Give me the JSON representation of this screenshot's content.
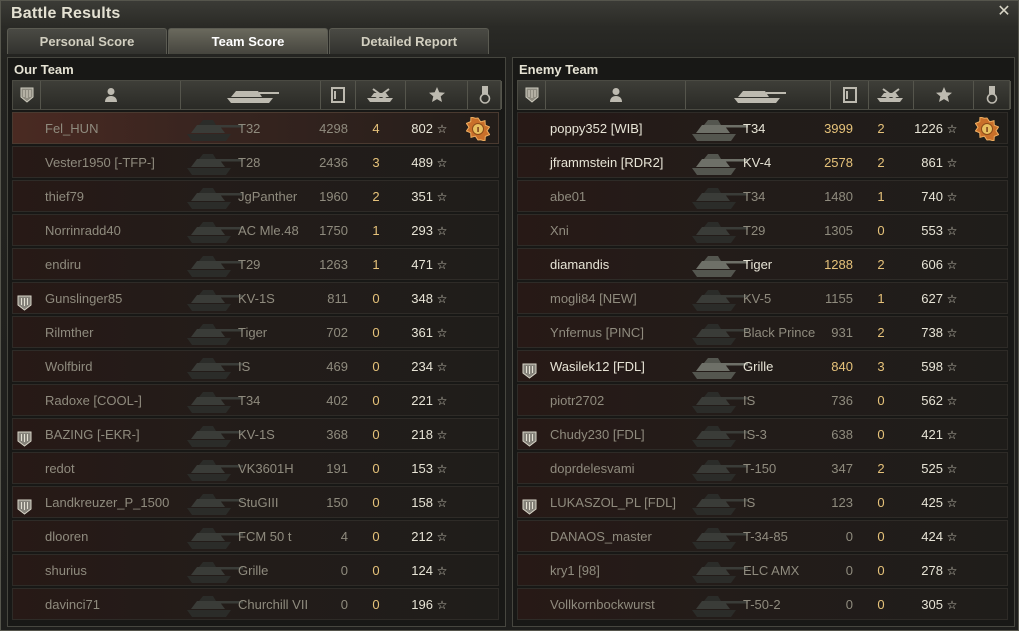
{
  "window": {
    "title": "Battle Results"
  },
  "tabs": [
    {
      "label": "Personal Score",
      "active": false
    },
    {
      "label": "Team Score",
      "active": true
    },
    {
      "label": "Detailed Report",
      "active": false
    }
  ],
  "columns_icons": [
    "badge-icon",
    "player-icon",
    "tank-icon",
    "damage-icon",
    "kills-icon",
    "experience-icon",
    "medal-icon"
  ],
  "our_team": {
    "title": "Our Team",
    "rows": [
      {
        "name": "Fel_HUN",
        "tank": "T32",
        "damage": "4298",
        "kills": "4",
        "xp": "802",
        "badge": false,
        "medal": true,
        "alive": false,
        "self": true
      },
      {
        "name": "Vester1950 [-TFP-]",
        "tank": "T28",
        "damage": "2436",
        "kills": "3",
        "xp": "489",
        "badge": false,
        "medal": false,
        "alive": false
      },
      {
        "name": "thief79",
        "tank": "JgPanther",
        "damage": "1960",
        "kills": "2",
        "xp": "351",
        "badge": false,
        "medal": false,
        "alive": false
      },
      {
        "name": "Norrinradd40",
        "tank": "AC Mle.48",
        "damage": "1750",
        "kills": "1",
        "xp": "293",
        "badge": false,
        "medal": false,
        "alive": false
      },
      {
        "name": "endiru",
        "tank": "T29",
        "damage": "1263",
        "kills": "1",
        "xp": "471",
        "badge": false,
        "medal": false,
        "alive": false
      },
      {
        "name": "Gunslinger85",
        "tank": "KV-1S",
        "damage": "811",
        "kills": "0",
        "xp": "348",
        "badge": true,
        "medal": false,
        "alive": false
      },
      {
        "name": "Rilmther",
        "tank": "Tiger",
        "damage": "702",
        "kills": "0",
        "xp": "361",
        "badge": false,
        "medal": false,
        "alive": false
      },
      {
        "name": "Wolfbird",
        "tank": "IS",
        "damage": "469",
        "kills": "0",
        "xp": "234",
        "badge": false,
        "medal": false,
        "alive": false
      },
      {
        "name": "Radoxe [COOL-]",
        "tank": "T34",
        "damage": "402",
        "kills": "0",
        "xp": "221",
        "badge": false,
        "medal": false,
        "alive": false
      },
      {
        "name": "BAZING [-EKR-]",
        "tank": "KV-1S",
        "damage": "368",
        "kills": "0",
        "xp": "218",
        "badge": true,
        "medal": false,
        "alive": false
      },
      {
        "name": "redot",
        "tank": "VK3601H",
        "damage": "191",
        "kills": "0",
        "xp": "153",
        "badge": false,
        "medal": false,
        "alive": false
      },
      {
        "name": "Landkreuzer_P_1500",
        "tank": "StuGIII",
        "damage": "150",
        "kills": "0",
        "xp": "158",
        "badge": true,
        "medal": false,
        "alive": false
      },
      {
        "name": "dlooren",
        "tank": "FCM 50 t",
        "damage": "4",
        "kills": "0",
        "xp": "212",
        "badge": false,
        "medal": false,
        "alive": false
      },
      {
        "name": "shurius",
        "tank": "Grille",
        "damage": "0",
        "kills": "0",
        "xp": "124",
        "badge": false,
        "medal": false,
        "alive": false
      },
      {
        "name": "davinci71",
        "tank": "Churchill VII",
        "damage": "0",
        "kills": "0",
        "xp": "196",
        "badge": false,
        "medal": false,
        "alive": false
      }
    ]
  },
  "enemy_team": {
    "title": "Enemy Team",
    "rows": [
      {
        "name": "poppy352 [WIB]",
        "tank": "T34",
        "damage": "3999",
        "kills": "2",
        "xp": "1226",
        "badge": false,
        "medal": true,
        "alive": true
      },
      {
        "name": "jframmstein [RDR2]",
        "tank": "KV-4",
        "damage": "2578",
        "kills": "2",
        "xp": "861",
        "badge": false,
        "medal": false,
        "alive": true
      },
      {
        "name": "abe01",
        "tank": "T34",
        "damage": "1480",
        "kills": "1",
        "xp": "740",
        "badge": false,
        "medal": false,
        "alive": false
      },
      {
        "name": "Xni",
        "tank": "T29",
        "damage": "1305",
        "kills": "0",
        "xp": "553",
        "badge": false,
        "medal": false,
        "alive": false
      },
      {
        "name": "diamandis",
        "tank": "Tiger",
        "damage": "1288",
        "kills": "2",
        "xp": "606",
        "badge": false,
        "medal": false,
        "alive": true
      },
      {
        "name": "mogli84 [NEW]",
        "tank": "KV-5",
        "damage": "1155",
        "kills": "1",
        "xp": "627",
        "badge": false,
        "medal": false,
        "alive": false
      },
      {
        "name": "Ynfernus [PINC]",
        "tank": "Black Prince",
        "damage": "931",
        "kills": "2",
        "xp": "738",
        "badge": false,
        "medal": false,
        "alive": false
      },
      {
        "name": "Wasilek12 [FDL]",
        "tank": "Grille",
        "damage": "840",
        "kills": "3",
        "xp": "598",
        "badge": true,
        "medal": false,
        "alive": true
      },
      {
        "name": "piotr2702",
        "tank": "IS",
        "damage": "736",
        "kills": "0",
        "xp": "562",
        "badge": false,
        "medal": false,
        "alive": false
      },
      {
        "name": "Chudy230 [FDL]",
        "tank": "IS-3",
        "damage": "638",
        "kills": "0",
        "xp": "421",
        "badge": true,
        "medal": false,
        "alive": false
      },
      {
        "name": "doprdelesvami",
        "tank": "T-150",
        "damage": "347",
        "kills": "2",
        "xp": "525",
        "badge": false,
        "medal": false,
        "alive": false
      },
      {
        "name": "LUKASZOL_PL [FDL]",
        "tank": "IS",
        "damage": "123",
        "kills": "0",
        "xp": "425",
        "badge": true,
        "medal": false,
        "alive": false
      },
      {
        "name": "DANAOS_master",
        "tank": "T-34-85",
        "damage": "0",
        "kills": "0",
        "xp": "424",
        "badge": false,
        "medal": false,
        "alive": false
      },
      {
        "name": "kry1 [98]",
        "tank": "ELC AMX",
        "damage": "0",
        "kills": "0",
        "xp": "278",
        "badge": false,
        "medal": false,
        "alive": false
      },
      {
        "name": "Vollkornbockwurst",
        "tank": "T-50-2",
        "damage": "0",
        "kills": "0",
        "xp": "305",
        "badge": false,
        "medal": false,
        "alive": false
      }
    ]
  },
  "star_glyph": "☆",
  "colors": {
    "alive_text": "#e7e4d6",
    "dead_text": "#8f8b7e",
    "damage_alive": "#e6c27a",
    "accent_row": "#4a2a22"
  }
}
